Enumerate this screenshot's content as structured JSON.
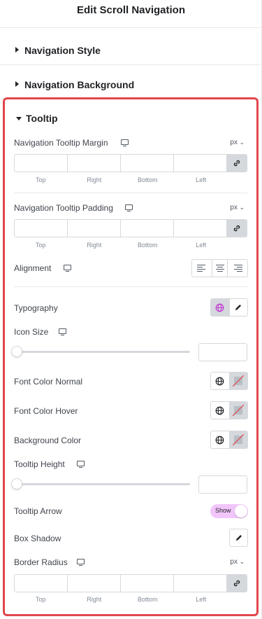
{
  "header": {
    "title": "Edit Scroll Navigation"
  },
  "sections": [
    {
      "label": "Navigation Style",
      "expanded": false
    },
    {
      "label": "Navigation Background",
      "expanded": false
    }
  ],
  "tooltip_panel": {
    "title": "Tooltip",
    "expanded": true,
    "border_color": "#e0474c",
    "dimension_labels": [
      "Top",
      "Right",
      "Bottom",
      "Left"
    ],
    "margin": {
      "label": "Navigation Tooltip Margin",
      "unit": "px",
      "icon": "desktop-icon"
    },
    "padding": {
      "label": "Navigation Tooltip Padding",
      "unit": "px",
      "icon": "desktop-icon"
    },
    "alignment": {
      "label": "Alignment",
      "icon": "desktop-icon",
      "options": [
        "align-left-icon",
        "align-center-icon",
        "align-right-icon"
      ]
    },
    "typography": {
      "label": "Typography",
      "icons": [
        "globe-icon",
        "pencil-icon"
      ],
      "accent": "#c036d3"
    },
    "icon_size": {
      "label": "Icon Size",
      "value": "",
      "level": 0
    },
    "font_color_normal": {
      "label": "Font Color Normal",
      "icons": [
        "globe-icon",
        "no-color-swatch-icon"
      ]
    },
    "font_color_hover": {
      "label": "Font Color Hover",
      "icons": [
        "globe-icon",
        "no-color-swatch-icon"
      ]
    },
    "background_color": {
      "label": "Background Color",
      "icons": [
        "globe-icon",
        "no-color-swatch-icon"
      ]
    },
    "tooltip_height": {
      "label": "Tooltip Height",
      "value": "",
      "level": 0
    },
    "tooltip_arrow": {
      "label": "Tooltip Arrow",
      "toggle_text": "Show",
      "on": true,
      "toggle_color": "#f2c6fb"
    },
    "box_shadow": {
      "label": "Box Shadow",
      "icon": "pencil-icon"
    },
    "border_radius": {
      "label": "Border Radius",
      "unit": "px",
      "icon": "desktop-icon"
    }
  }
}
